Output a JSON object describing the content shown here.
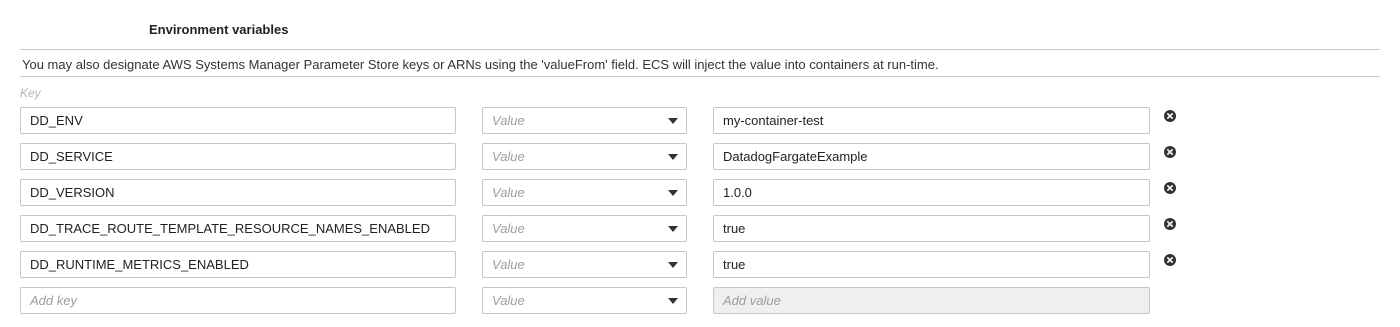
{
  "section": {
    "title": "Environment variables",
    "info": "You may also designate AWS Systems Manager Parameter Store keys or ARNs using the 'valueFrom' field. ECS will inject the value into containers at run-time."
  },
  "table": {
    "key_header": "Key",
    "rows": [
      {
        "key": "DD_ENV",
        "type": "Value",
        "value": "my-container-test"
      },
      {
        "key": "DD_SERVICE",
        "type": "Value",
        "value": "DatadogFargateExample"
      },
      {
        "key": "DD_VERSION",
        "type": "Value",
        "value": "1.0.0"
      },
      {
        "key": "DD_TRACE_ROUTE_TEMPLATE_RESOURCE_NAMES_ENABLED",
        "type": "Value",
        "value": "true"
      },
      {
        "key": "DD_RUNTIME_METRICS_ENABLED",
        "type": "Value",
        "value": "true"
      }
    ],
    "new_row": {
      "key_placeholder": "Add key",
      "type": "Value",
      "value_placeholder": "Add value"
    }
  },
  "icons": {
    "remove": "remove-circle-icon",
    "dropdown": "caret-down-icon"
  }
}
